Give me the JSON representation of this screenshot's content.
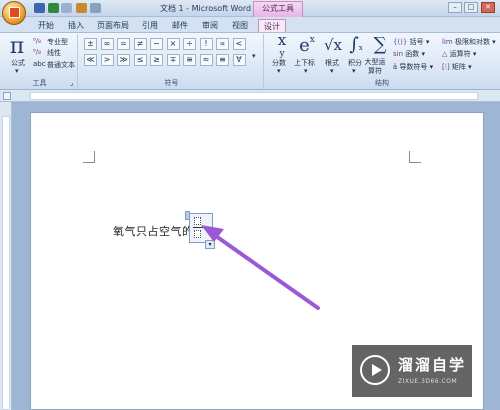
{
  "window": {
    "title": "文档 1 - Microsoft Word",
    "context_tab_group": "公式工具",
    "controls": [
      "–",
      "□",
      "✕"
    ]
  },
  "tabs": [
    {
      "label": "开始"
    },
    {
      "label": "插入"
    },
    {
      "label": "页面布局"
    },
    {
      "label": "引用"
    },
    {
      "label": "邮件"
    },
    {
      "label": "审阅"
    },
    {
      "label": "视图"
    },
    {
      "label": "设计"
    }
  ],
  "ribbon": {
    "tools_group": {
      "label": "工具",
      "formula_button": "公式",
      "professional": "专业型",
      "linear": "线性",
      "normal_text": "普通文本",
      "normal_text_prefix": "abc"
    },
    "symbols_group": {
      "label": "符号",
      "row1": [
        "±",
        "∞",
        "=",
        "≠",
        "~",
        "×",
        "÷",
        "!",
        "∝",
        "<"
      ],
      "row2": [
        "≪",
        ">",
        "≫",
        "≤",
        "≥",
        "∓",
        "≅",
        "≈",
        "≡",
        "∀"
      ]
    },
    "structures_group": {
      "label": "结构",
      "fraction": "分数",
      "script": "上下标",
      "radical": "根式",
      "integral": "积分",
      "large_operator": "大型运算符",
      "bracket": "括号",
      "function": "函数",
      "accent": "导数符号",
      "limit_log": "极限和对数",
      "operator": "运算符",
      "matrix": "矩阵"
    }
  },
  "document": {
    "body_text": "氧气只占空气的"
  },
  "watermark": {
    "title": "溜溜自学",
    "subtitle": "ZIXUE.3D66.COM"
  },
  "colors": {
    "ribbon_bg": "#dae6f4",
    "context_tab": "#e6b6e4",
    "arrow": "#9b59d6",
    "page": "#ffffff"
  }
}
